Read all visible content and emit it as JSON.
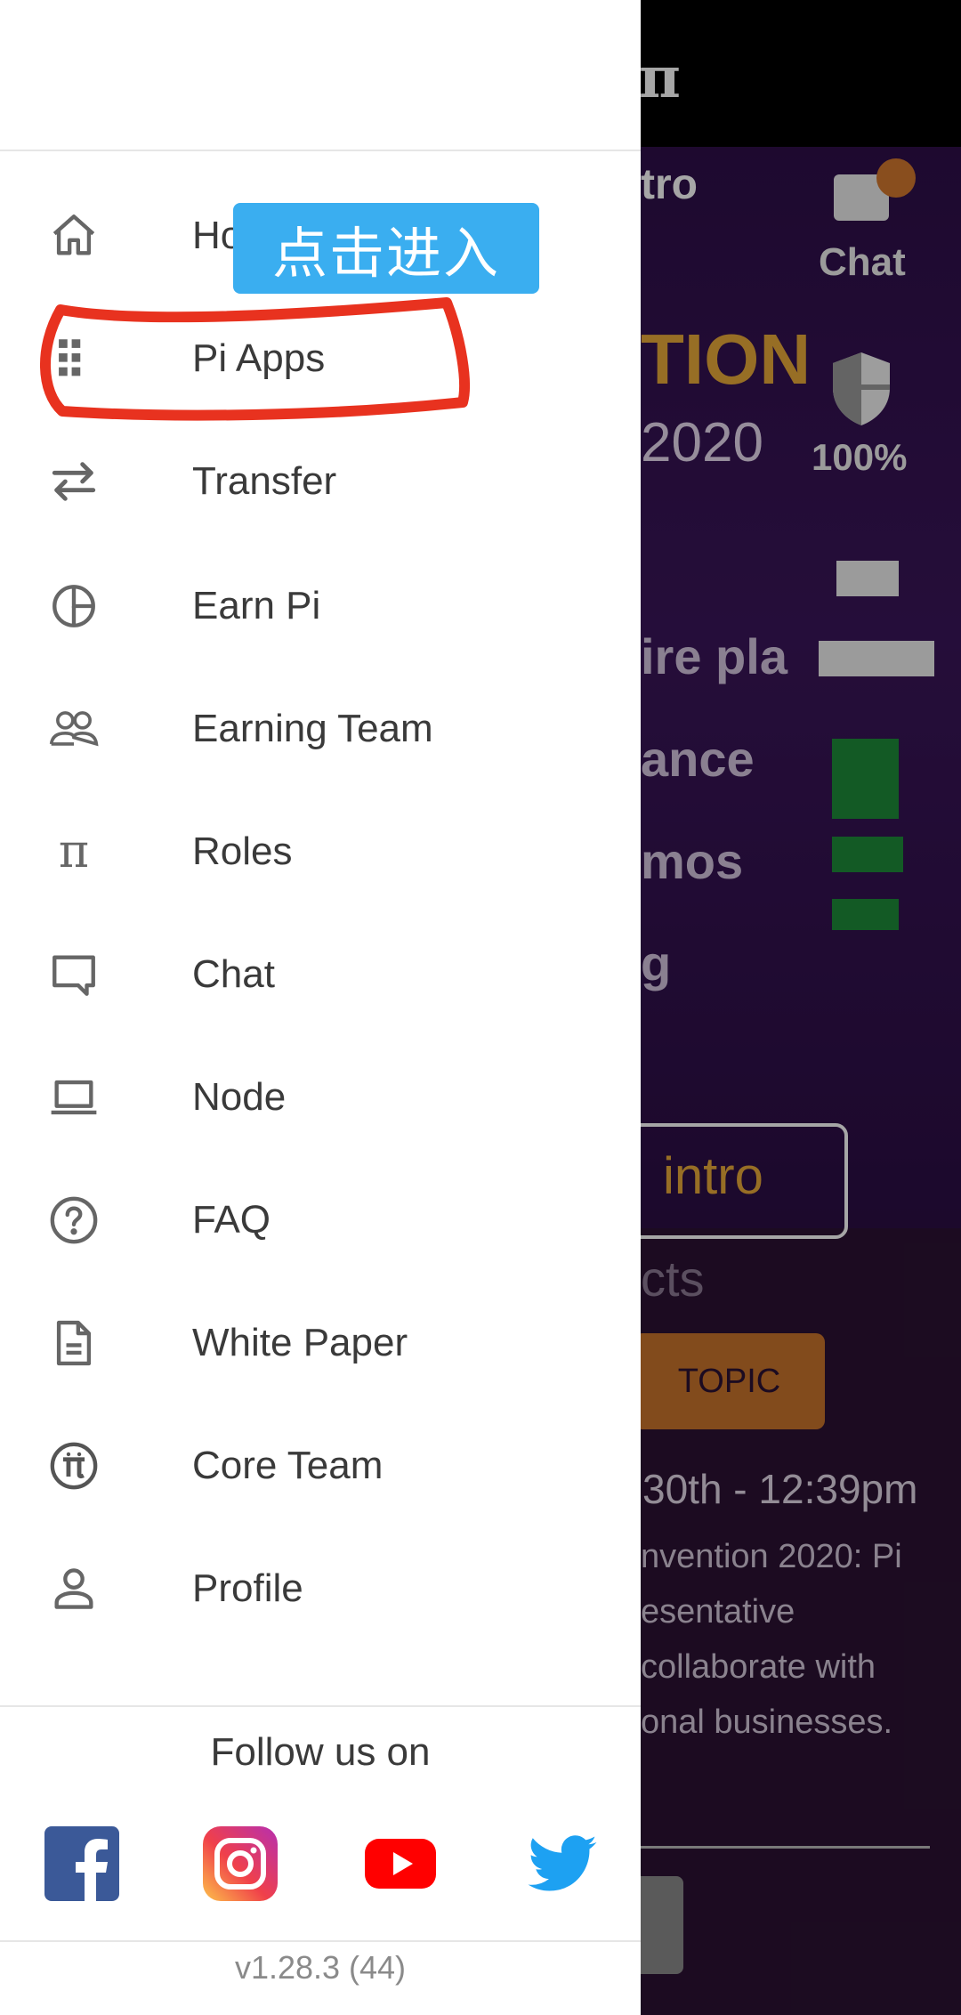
{
  "background_app": {
    "logo": "π",
    "intro_partial": "tro",
    "hero_partial": "TION",
    "year_partial": "2020",
    "lines": [
      "ire pla",
      "ance",
      "mos",
      "g"
    ],
    "intro_button": "intro",
    "facts_partial": "cts",
    "topic_badge": "TOPIC",
    "date_partial": "30th - 12:39pm",
    "desc_lines": [
      "nvention 2020: Pi",
      "esentative",
      "collaborate with",
      "onal businesses."
    ],
    "rail": {
      "chat_label": "Chat",
      "security_percent": "100%"
    }
  },
  "drawer": {
    "menu": [
      {
        "label": "Home",
        "icon": "home-icon"
      },
      {
        "label": "Pi Apps",
        "icon": "grid-icon"
      },
      {
        "label": "Transfer",
        "icon": "transfer-icon"
      },
      {
        "label": "Earn Pi",
        "icon": "pie-chart-icon"
      },
      {
        "label": "Earning Team",
        "icon": "team-icon"
      },
      {
        "label": "Roles",
        "icon": "pi-icon"
      },
      {
        "label": "Chat",
        "icon": "chat-icon"
      },
      {
        "label": "Node",
        "icon": "laptop-icon"
      },
      {
        "label": "FAQ",
        "icon": "help-icon"
      },
      {
        "label": "White Paper",
        "icon": "document-icon"
      },
      {
        "label": "Core Team",
        "icon": "pi-coin-icon"
      },
      {
        "label": "Profile",
        "icon": "person-icon"
      }
    ],
    "follow_title": "Follow us on",
    "social": [
      "facebook-icon",
      "instagram-icon",
      "youtube-icon",
      "twitter-icon"
    ],
    "version": "v1.28.3 (44)"
  },
  "annotation": {
    "callout_text": "点击进入"
  },
  "colors": {
    "callout_bg": "#3aaef0",
    "highlight_red": "#e8321f",
    "facebook": "#3b5998",
    "youtube": "#ff0000",
    "twitter": "#1da1f2",
    "topic_badge": "#c8732c"
  }
}
